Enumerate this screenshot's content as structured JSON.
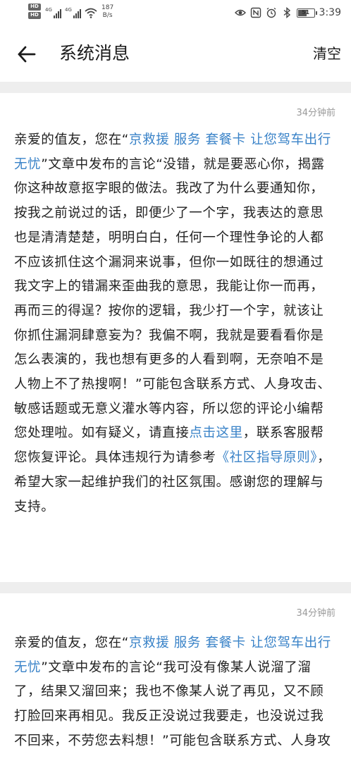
{
  "status_bar": {
    "hd1": "HD",
    "hd2": "HD",
    "net1": "4G",
    "net2": "4G",
    "speed_value": "187",
    "speed_unit": "B/s",
    "battery_level": "51",
    "time": "3:39"
  },
  "header": {
    "back_icon": "arrow-left-icon",
    "title": "系统消息",
    "clear_label": "清空"
  },
  "messages": [
    {
      "time": "34分钟前",
      "prefix": "亲爱的值友，您在“",
      "article_link": "京救援 服务 套餐卡 让您驾车出行无忧",
      "mid": "”文章中发布的言论“没错，就是要恶心你，揭露你这种故意抠字眼的做法。我改了为什么要通知你，按我之前说过的话，即便少了一个字，我表达的意思也是清清楚楚，明明白白，任何一个理性争论的人都不应该抓住这个漏洞来说事，但你一如既往的想通过我文字上的错漏来歪曲我的意思，我能让你一而再，再而三的得逞？按你的逻辑，我少打一个字，就该让你抓住漏洞肆意妄为？我偏不啊，我就是要看看你是怎么表演的，我也想有更多的人看到啊，无奈咱不是人物上不了热搜啊！”可能包含联系方式、人身攻击、敏感话题或无意义灌水等内容，所以您的评论小编帮您处理啦。如有疑义，请直接",
      "contact_link": "点击这里",
      "mid2": "，联系客服帮您恢复评论。具体违规行为请参考",
      "rules_link": "《社区指导原则》",
      "suffix": "，希望大家一起维护我们的社区氛围。感谢您的理解与支持。"
    },
    {
      "time": "34分钟前",
      "prefix": "亲爱的值友，您在“",
      "article_link": "京救援 服务 套餐卡 让您驾车出行无忧",
      "mid": "”文章中发布的言论“我可没有像某人说溜了溜了，结果又溜回来；我也不像某人说了再见，又不顾打脸回来再相见。我反正没说过我要走，也没说过我不回来，不劳您去料想！”可能包含联系方式、人身攻"
    }
  ]
}
